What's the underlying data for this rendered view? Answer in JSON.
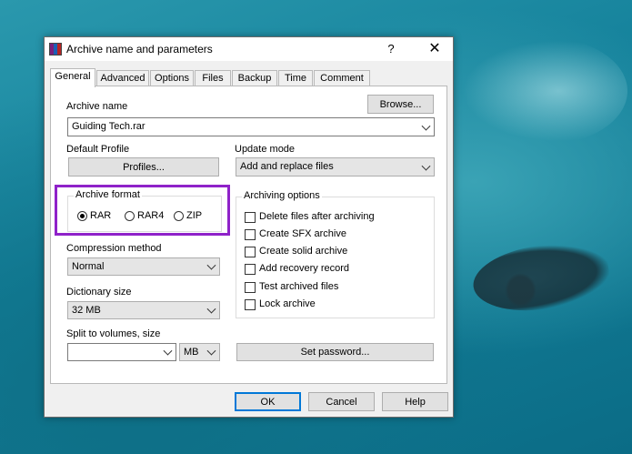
{
  "dialog": {
    "title": "Archive name and parameters",
    "help_label": "?",
    "close_label": "✕"
  },
  "tabs": [
    "General",
    "Advanced",
    "Options",
    "Files",
    "Backup",
    "Time",
    "Comment"
  ],
  "general": {
    "archive_name_label": "Archive name",
    "browse_label": "Browse...",
    "archive_name_value": "Guiding Tech.rar",
    "default_profile_label": "Default Profile",
    "profiles_label": "Profiles...",
    "update_mode_label": "Update mode",
    "update_mode_value": "Add and replace files",
    "archive_format_label": "Archive format",
    "formats": [
      "RAR",
      "RAR4",
      "ZIP"
    ],
    "selected_format": "RAR",
    "compression_method_label": "Compression method",
    "compression_method_value": "Normal",
    "dictionary_size_label": "Dictionary size",
    "dictionary_size_value": "32 MB",
    "split_label": "Split to volumes, size",
    "split_value": "",
    "split_unit": "MB",
    "archiving_options_label": "Archiving options",
    "options": [
      "Delete files after archiving",
      "Create SFX archive",
      "Create solid archive",
      "Add recovery record",
      "Test archived files",
      "Lock archive"
    ],
    "set_password_label": "Set password..."
  },
  "footer": {
    "ok_label": "OK",
    "cancel_label": "Cancel",
    "help_label": "Help"
  },
  "colors": {
    "highlight": "#8f22c9",
    "default_button_border": "#0078d7"
  }
}
